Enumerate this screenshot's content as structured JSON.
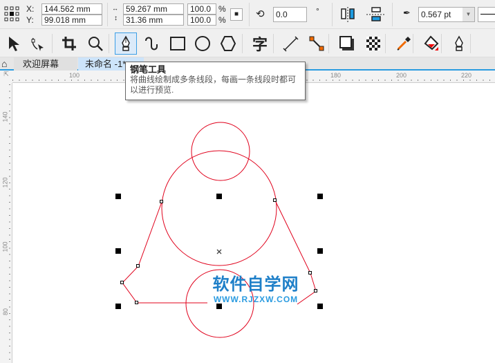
{
  "propbar": {
    "x_label": "X:",
    "y_label": "Y:",
    "x_value": "144.562 mm",
    "y_value": "99.018 mm",
    "width_value": "59.267 mm",
    "height_value": "31.36 mm",
    "scale_x": "100.0",
    "scale_y": "100.0",
    "percent": "%",
    "rotation": "0.0",
    "degree": "°",
    "outline_width": "0.567 pt"
  },
  "tools": [
    "pick-tool",
    "shape-tool",
    "crop-tool",
    "zoom-tool",
    "pen-tool",
    "artistic-media-tool",
    "rectangle-tool",
    "ellipse-tool",
    "polygon-tool",
    "text-tool",
    "dimension-tool",
    "connector-tool",
    "drop-shadow-tool",
    "transparency-tool",
    "eyedropper-tool",
    "interactive-fill-tool",
    "outline-pen-tool"
  ],
  "text_tool_glyph": "字",
  "tabs": {
    "welcome": "欢迎屏幕",
    "document": "未命名 -1*"
  },
  "tooltip": {
    "title": "钢笔工具",
    "body": "将曲线绘制成多条线段，每画一条线段时都可以进行预览."
  },
  "ruler": {
    "h": [
      "100",
      "180",
      "200",
      "220"
    ],
    "v": [
      "140",
      "120",
      "100",
      "80"
    ]
  },
  "watermark": {
    "title": "软件自学网",
    "url": "WWW.RJZXW.COM"
  },
  "colors": {
    "curve": "#e0001b",
    "accent": "#2a9be0",
    "watermark": "#1e7fc8"
  }
}
